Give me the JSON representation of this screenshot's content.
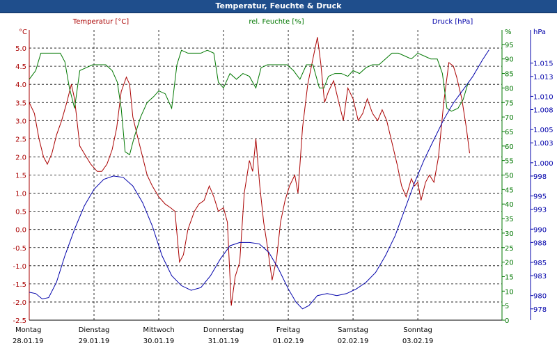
{
  "window": {
    "title": "Temperatur, Feuchte & Druck"
  },
  "colors": {
    "temperature": "#aa0000",
    "humidity": "#007700",
    "pressure": "#0000aa",
    "grid": "#000000",
    "title_bar": "#1f4e8c"
  },
  "chart_data": {
    "type": "line",
    "title": "Temperatur, Feuchte & Druck",
    "x_domain": [
      0,
      7.3
    ],
    "x_labels": [
      {
        "x": 0,
        "day": "Montag",
        "date": "28.01.19"
      },
      {
        "x": 1,
        "day": "Dienstag",
        "date": "29.01.19"
      },
      {
        "x": 2,
        "day": "Mittwoch",
        "date": "30.01.19"
      },
      {
        "x": 3,
        "day": "Donnerstag",
        "date": "31.01.19"
      },
      {
        "x": 4,
        "day": "Freitag",
        "date": "01.02.19"
      },
      {
        "x": 5,
        "day": "Samstag",
        "date": "02.02.19"
      },
      {
        "x": 6,
        "day": "Sonntag",
        "date": "03.02.19"
      }
    ],
    "grid": true,
    "axes": {
      "temperature": {
        "unit": "°C",
        "min": -2.5,
        "max": 5.5,
        "side": "left",
        "ticks": [
          "-2.5",
          "-2.0",
          "-1.5",
          "-1.0",
          "-0.5",
          "0.0",
          "0.5",
          "1.0",
          "1.5",
          "2.0",
          "2.5",
          "3.0",
          "3.5",
          "4.0",
          "4.5",
          "5.0"
        ]
      },
      "humidity": {
        "unit": "%",
        "min": 0,
        "max": 100,
        "side": "right",
        "ticks": [
          "0",
          "5",
          "10",
          "15",
          "20",
          "25",
          "30",
          "35",
          "40",
          "45",
          "50",
          "55",
          "60",
          "65",
          "70",
          "75",
          "80",
          "85",
          "90",
          "95"
        ]
      },
      "pressure": {
        "unit": "hPa",
        "min": 976.3,
        "max": 1020,
        "side": "right",
        "ticks": [
          "978",
          "980",
          "983",
          "985",
          "988",
          "990",
          "993",
          "995",
          "998",
          "1.000",
          "1.003",
          "1.005",
          "1.008",
          "1.010",
          "1.013",
          "1.015"
        ]
      }
    },
    "series": [
      {
        "name": "Temperatur [°C]",
        "axis": "temperature",
        "points": [
          [
            0,
            3.5
          ],
          [
            0.08,
            3.2
          ],
          [
            0.15,
            2.5
          ],
          [
            0.22,
            2.0
          ],
          [
            0.28,
            1.8
          ],
          [
            0.35,
            2.1
          ],
          [
            0.42,
            2.6
          ],
          [
            0.5,
            3.0
          ],
          [
            0.58,
            3.5
          ],
          [
            0.65,
            4.0
          ],
          [
            0.7,
            3.6
          ],
          [
            0.78,
            2.3
          ],
          [
            0.88,
            2.0
          ],
          [
            0.95,
            1.8
          ],
          [
            1.05,
            1.6
          ],
          [
            1.12,
            1.6
          ],
          [
            1.2,
            1.8
          ],
          [
            1.28,
            2.2
          ],
          [
            1.35,
            2.8
          ],
          [
            1.42,
            3.8
          ],
          [
            1.5,
            4.2
          ],
          [
            1.55,
            4.0
          ],
          [
            1.6,
            3.1
          ],
          [
            1.68,
            2.5
          ],
          [
            1.75,
            2.0
          ],
          [
            1.82,
            1.5
          ],
          [
            1.9,
            1.2
          ],
          [
            2.0,
            0.9
          ],
          [
            2.1,
            0.7
          ],
          [
            2.18,
            0.6
          ],
          [
            2.25,
            0.5
          ],
          [
            2.32,
            -0.9
          ],
          [
            2.38,
            -0.7
          ],
          [
            2.45,
            0.0
          ],
          [
            2.55,
            0.5
          ],
          [
            2.62,
            0.7
          ],
          [
            2.7,
            0.8
          ],
          [
            2.78,
            1.2
          ],
          [
            2.85,
            0.9
          ],
          [
            2.92,
            0.5
          ],
          [
            3.0,
            0.6
          ],
          [
            3.06,
            0.2
          ],
          [
            3.12,
            -2.1
          ],
          [
            3.18,
            -1.3
          ],
          [
            3.25,
            -0.9
          ],
          [
            3.32,
            1.0
          ],
          [
            3.4,
            1.9
          ],
          [
            3.45,
            1.6
          ],
          [
            3.5,
            2.5
          ],
          [
            3.56,
            1.2
          ],
          [
            3.62,
            0.2
          ],
          [
            3.68,
            -0.5
          ],
          [
            3.75,
            -1.4
          ],
          [
            3.82,
            -0.8
          ],
          [
            3.88,
            0.2
          ],
          [
            3.95,
            0.8
          ],
          [
            4.02,
            1.2
          ],
          [
            4.1,
            1.5
          ],
          [
            4.15,
            1.0
          ],
          [
            4.22,
            2.8
          ],
          [
            4.3,
            4.0
          ],
          [
            4.38,
            4.7
          ],
          [
            4.45,
            5.3
          ],
          [
            4.5,
            4.6
          ],
          [
            4.56,
            3.5
          ],
          [
            4.62,
            3.8
          ],
          [
            4.7,
            4.1
          ],
          [
            4.78,
            3.5
          ],
          [
            4.85,
            3.0
          ],
          [
            4.92,
            3.9
          ],
          [
            5.0,
            3.6
          ],
          [
            5.08,
            3.0
          ],
          [
            5.15,
            3.2
          ],
          [
            5.22,
            3.6
          ],
          [
            5.3,
            3.2
          ],
          [
            5.38,
            3.0
          ],
          [
            5.45,
            3.3
          ],
          [
            5.52,
            3.0
          ],
          [
            5.6,
            2.4
          ],
          [
            5.68,
            1.8
          ],
          [
            5.75,
            1.2
          ],
          [
            5.82,
            0.9
          ],
          [
            5.9,
            1.4
          ],
          [
            5.95,
            1.2
          ],
          [
            6.0,
            1.3
          ],
          [
            6.05,
            0.8
          ],
          [
            6.12,
            1.3
          ],
          [
            6.18,
            1.5
          ],
          [
            6.25,
            1.3
          ],
          [
            6.32,
            2.0
          ],
          [
            6.4,
            3.5
          ],
          [
            6.48,
            4.6
          ],
          [
            6.55,
            4.5
          ],
          [
            6.6,
            4.2
          ],
          [
            6.68,
            3.6
          ],
          [
            6.75,
            2.8
          ],
          [
            6.8,
            2.1
          ]
        ]
      },
      {
        "name": "rel. Feuchte [%]",
        "axis": "humidity",
        "points": [
          [
            0,
            83
          ],
          [
            0.1,
            86
          ],
          [
            0.18,
            92
          ],
          [
            0.28,
            92
          ],
          [
            0.38,
            92
          ],
          [
            0.48,
            92
          ],
          [
            0.55,
            89
          ],
          [
            0.62,
            80
          ],
          [
            0.7,
            73
          ],
          [
            0.78,
            86
          ],
          [
            0.88,
            87
          ],
          [
            0.98,
            88
          ],
          [
            1.08,
            88
          ],
          [
            1.18,
            88
          ],
          [
            1.28,
            86
          ],
          [
            1.36,
            82
          ],
          [
            1.42,
            73
          ],
          [
            1.48,
            58
          ],
          [
            1.55,
            57
          ],
          [
            1.62,
            63
          ],
          [
            1.72,
            70
          ],
          [
            1.82,
            75
          ],
          [
            1.92,
            77
          ],
          [
            2.0,
            79
          ],
          [
            2.1,
            78
          ],
          [
            2.2,
            73
          ],
          [
            2.28,
            88
          ],
          [
            2.35,
            93
          ],
          [
            2.45,
            92
          ],
          [
            2.55,
            92
          ],
          [
            2.65,
            92
          ],
          [
            2.75,
            93
          ],
          [
            2.85,
            92
          ],
          [
            2.92,
            82
          ],
          [
            3.0,
            80
          ],
          [
            3.1,
            85
          ],
          [
            3.2,
            83
          ],
          [
            3.3,
            85
          ],
          [
            3.4,
            84
          ],
          [
            3.5,
            80
          ],
          [
            3.58,
            87
          ],
          [
            3.68,
            88
          ],
          [
            3.78,
            88
          ],
          [
            3.88,
            88
          ],
          [
            3.98,
            88
          ],
          [
            4.08,
            86
          ],
          [
            4.18,
            83
          ],
          [
            4.28,
            88
          ],
          [
            4.38,
            88
          ],
          [
            4.48,
            80
          ],
          [
            4.55,
            80
          ],
          [
            4.62,
            84
          ],
          [
            4.72,
            85
          ],
          [
            4.82,
            85
          ],
          [
            4.92,
            84
          ],
          [
            5.0,
            86
          ],
          [
            5.1,
            85
          ],
          [
            5.2,
            87
          ],
          [
            5.3,
            88
          ],
          [
            5.4,
            88
          ],
          [
            5.5,
            90
          ],
          [
            5.6,
            92
          ],
          [
            5.7,
            92
          ],
          [
            5.8,
            91
          ],
          [
            5.9,
            90
          ],
          [
            6.0,
            92
          ],
          [
            6.1,
            91
          ],
          [
            6.2,
            90
          ],
          [
            6.3,
            90
          ],
          [
            6.38,
            85
          ],
          [
            6.45,
            73
          ],
          [
            6.52,
            72
          ],
          [
            6.62,
            73
          ],
          [
            6.7,
            76
          ],
          [
            6.78,
            82
          ]
        ]
      },
      {
        "name": "Druck [hPa]",
        "axis": "pressure",
        "points": [
          [
            0,
            980.5
          ],
          [
            0.1,
            980.3
          ],
          [
            0.2,
            979.5
          ],
          [
            0.3,
            979.7
          ],
          [
            0.42,
            982
          ],
          [
            0.55,
            986
          ],
          [
            0.7,
            990
          ],
          [
            0.85,
            993.5
          ],
          [
            1.0,
            996
          ],
          [
            1.15,
            997.5
          ],
          [
            1.3,
            998
          ],
          [
            1.45,
            997.8
          ],
          [
            1.6,
            996.5
          ],
          [
            1.75,
            994
          ],
          [
            1.9,
            990.5
          ],
          [
            2.05,
            986
          ],
          [
            2.2,
            983
          ],
          [
            2.35,
            981.5
          ],
          [
            2.5,
            980.8
          ],
          [
            2.65,
            981.2
          ],
          [
            2.8,
            983
          ],
          [
            2.95,
            985.5
          ],
          [
            3.1,
            987.5
          ],
          [
            3.25,
            988
          ],
          [
            3.4,
            988
          ],
          [
            3.55,
            987.8
          ],
          [
            3.7,
            986.5
          ],
          [
            3.85,
            984
          ],
          [
            4.0,
            981
          ],
          [
            4.12,
            979
          ],
          [
            4.22,
            978
          ],
          [
            4.32,
            978.5
          ],
          [
            4.45,
            980
          ],
          [
            4.6,
            980.3
          ],
          [
            4.75,
            980
          ],
          [
            4.9,
            980.3
          ],
          [
            5.05,
            981
          ],
          [
            5.2,
            982
          ],
          [
            5.35,
            983.5
          ],
          [
            5.5,
            986
          ],
          [
            5.65,
            989
          ],
          [
            5.8,
            993
          ],
          [
            5.95,
            997
          ],
          [
            6.1,
            1000.5
          ],
          [
            6.25,
            1003.5
          ],
          [
            6.4,
            1006.5
          ],
          [
            6.55,
            1009
          ],
          [
            6.7,
            1011
          ],
          [
            6.85,
            1013
          ],
          [
            7.0,
            1015.5
          ],
          [
            7.1,
            1017
          ]
        ]
      }
    ]
  }
}
